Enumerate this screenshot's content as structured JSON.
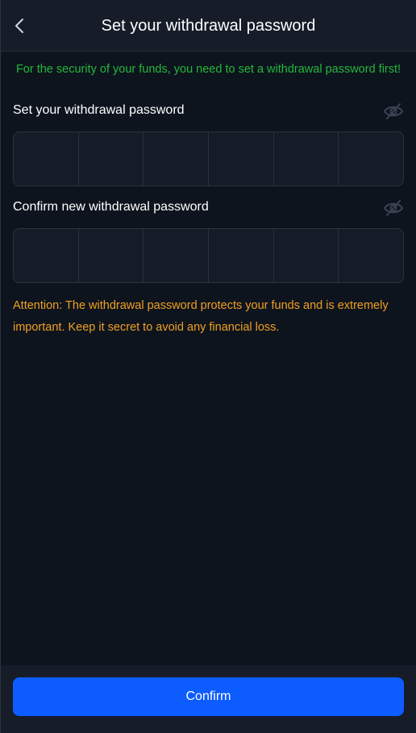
{
  "header": {
    "title": "Set your withdrawal password",
    "back_icon": "chevron-left-icon"
  },
  "notice": "For the security of your funds, you need to set a withdrawal password first!",
  "password_field": {
    "label": "Set your withdrawal password",
    "visibility_icon": "eye-off-icon",
    "digits": [
      "",
      "",
      "",
      "",
      "",
      ""
    ]
  },
  "confirm_field": {
    "label": "Confirm new withdrawal password",
    "visibility_icon": "eye-off-icon",
    "digits": [
      "",
      "",
      "",
      "",
      "",
      ""
    ]
  },
  "attention": "Attention: The withdrawal password protects your funds and is extremely important. Keep it secret to avoid any financial loss.",
  "footer": {
    "confirm_label": "Confirm"
  },
  "colors": {
    "background": "#0e141e",
    "notice_text": "#22b83a",
    "attention_text": "#f0a020",
    "primary_button": "#0d5cff"
  }
}
